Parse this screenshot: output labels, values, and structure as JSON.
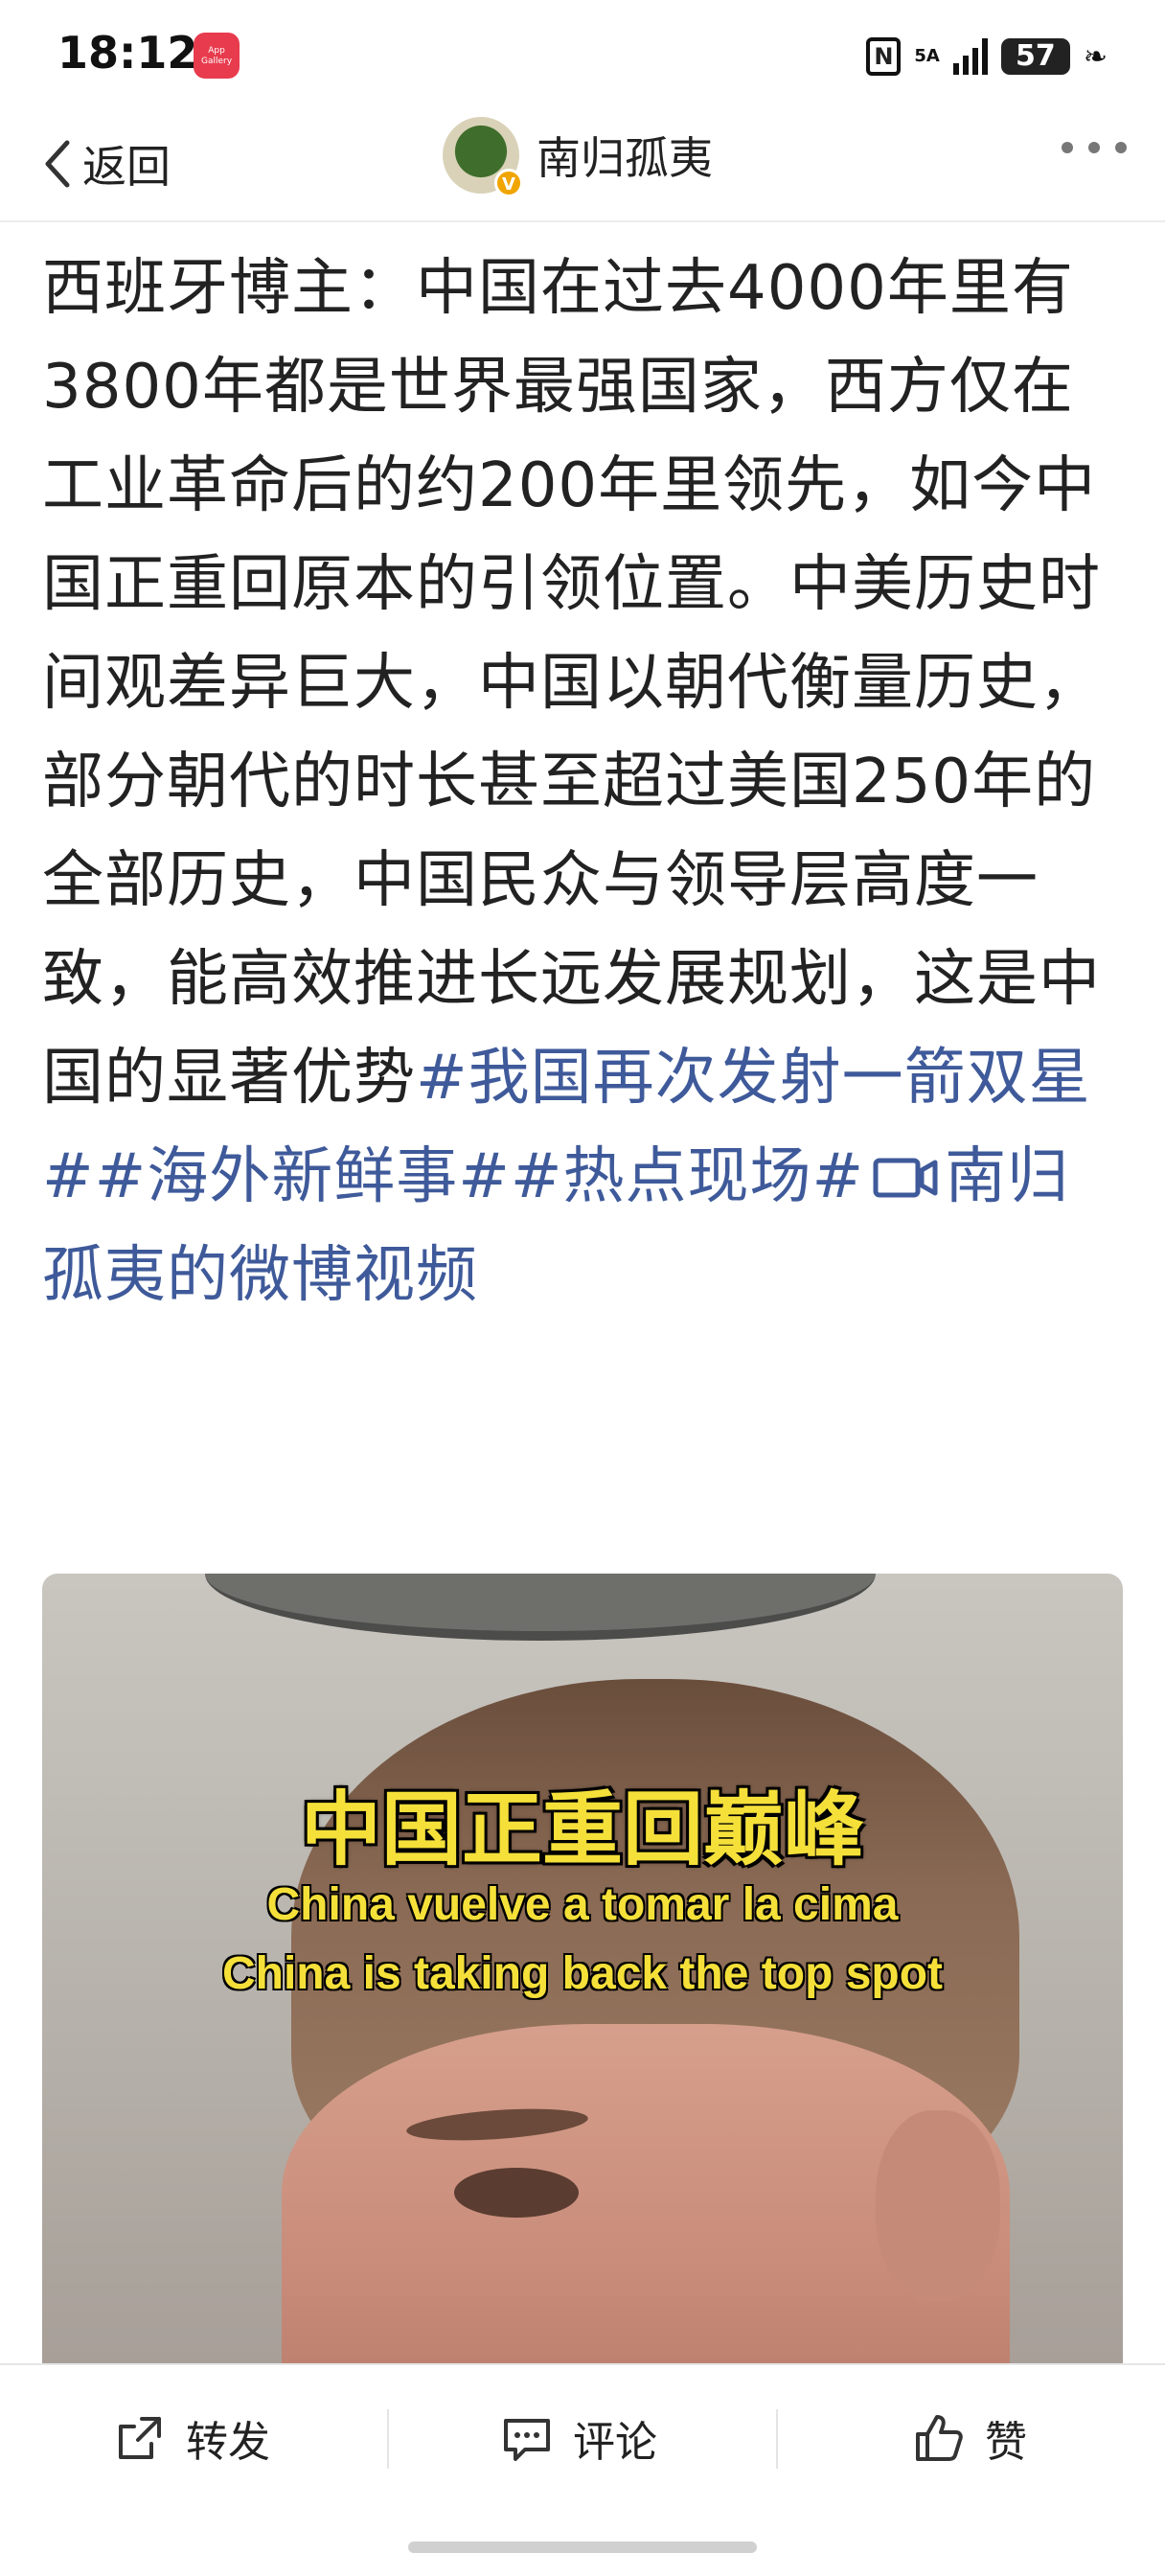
{
  "status_bar": {
    "time": "18:12",
    "app_icon_label": "App Gallery",
    "network": "5A",
    "battery": "57",
    "icons": [
      "nfc-icon",
      "signal-icon",
      "battery-icon",
      "power-saving-leaf-icon"
    ]
  },
  "nav": {
    "back_label": "返回",
    "author_name": "南归孤夷",
    "verified_badge": "V"
  },
  "post": {
    "body": "西班牙博主：中国在过去4000年里有3800年都是世界最强国家，西方仅在工业革命后的约200年里领先，如今中国正重回原本的引领位置。中美历史时间观差异巨大，中国以朝代衡量历史，部分朝代的时长甚至超过美国250年的全部历史，中国民众与领导层高度一致，能高效推进长远发展规划，这是中国的显著优势",
    "tags": [
      "#我国再次发射一箭双星#",
      "#海外新鲜事#",
      "#热点现场#"
    ],
    "video_link": "南归孤夷的微博视频"
  },
  "video": {
    "caption_cn": "中国正重回巅峰",
    "caption_es": "China vuelve a tomar la cima",
    "caption_en": "China is taking back the top spot"
  },
  "actions": {
    "repost": "转发",
    "comment": "评论",
    "like": "赞"
  },
  "colors": {
    "link": "#3f5a9a",
    "caption": "#f5e03a",
    "badge": "#f0a500"
  }
}
